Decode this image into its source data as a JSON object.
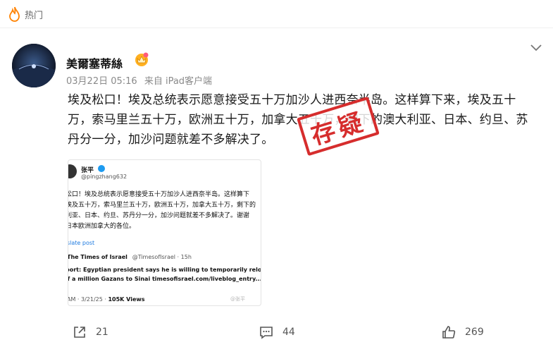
{
  "topbar": {
    "tag": "热门"
  },
  "author": {
    "name": "美爾塞蒂絲"
  },
  "meta": {
    "time": "03月22日 05:16",
    "source": "来自 iPad客户端"
  },
  "post": {
    "lines": [
      "埃及松口！埃及总统表示愿意接受五十万加沙人进西奈半岛。这样算下来，埃及五十",
      "万，索马里兰五十万，欧洲五十万，加拿大五十万，剩下的澳大利亚、日本、约旦、苏",
      "丹分一分，加沙问题就差不多解决了。"
    ]
  },
  "stamp": {
    "text": "存疑"
  },
  "embed": {
    "name": "张平",
    "handle": "@pingzhang632",
    "text_lines": [
      "松口！埃及总统表示愿意接受五十万加沙人进西奈半岛。这样算下",
      "埃及五十万，索马里兰五十万，欧洲五十万，加拿大五十万，剩下的",
      "利亚、日本、约旦、苏丹分一分，加沙问题就差不多解决了。谢谢",
      "日本欧洲加拿大的各位。"
    ],
    "link": "slate post",
    "quote_name": "The Times of Israel",
    "quote_handle": "@TimesofIsrael · 15h",
    "quote_lines": [
      "port: Egyptian president says he is willing to temporarily relocate",
      "lf a million Gazans to Sinai  timesofisrael.com/liveblog_entry..."
    ],
    "footer_time": "AM · 3/21/25 · ",
    "footer_views": "105K Views",
    "watermark": "@张平"
  },
  "actions": {
    "shares": "21",
    "comments": "44",
    "likes": "269"
  },
  "colors": {
    "accent": "#ff8200",
    "stamp": "#d62d2d",
    "link": "#1d7ae0"
  }
}
